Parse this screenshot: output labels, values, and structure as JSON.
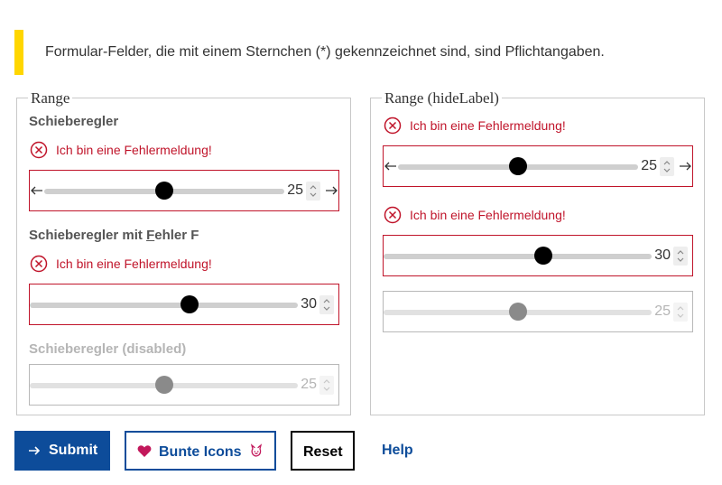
{
  "notice": {
    "text": "Formular-Felder, die mit einem Sternchen (*) gekennzeichnet sind, sind Pflichtangaben."
  },
  "left": {
    "legend": "Range",
    "field1": {
      "label": "Schieberegler",
      "error": "Ich bin eine Fehlermeldung!",
      "value": "25",
      "fraction": 0.5
    },
    "field2": {
      "label_before": "Schieberegler mit ",
      "label_underlined": "F",
      "label_after": "ehler F",
      "error": "Ich bin eine Fehlermeldung!",
      "value": "30",
      "fraction": 0.6
    },
    "field3": {
      "label": "Schieberegler (disabled)",
      "value": "25",
      "fraction": 0.5
    }
  },
  "right": {
    "legend": "Range (hideLabel)",
    "field1": {
      "error": "Ich bin eine Fehlermeldung!",
      "value": "25",
      "fraction": 0.5
    },
    "field2": {
      "error": "Ich bin eine Fehlermeldung!",
      "value": "30",
      "fraction": 0.6
    },
    "field3": {
      "value": "25",
      "fraction": 0.5
    }
  },
  "buttons": {
    "submit": "Submit",
    "icons": "Bunte Icons",
    "reset": "Reset",
    "help": "Help"
  },
  "colors": {
    "error": "#c0142a",
    "primary": "#0d4c9a",
    "notice": "#ffd600",
    "heart": "#c2185b"
  }
}
